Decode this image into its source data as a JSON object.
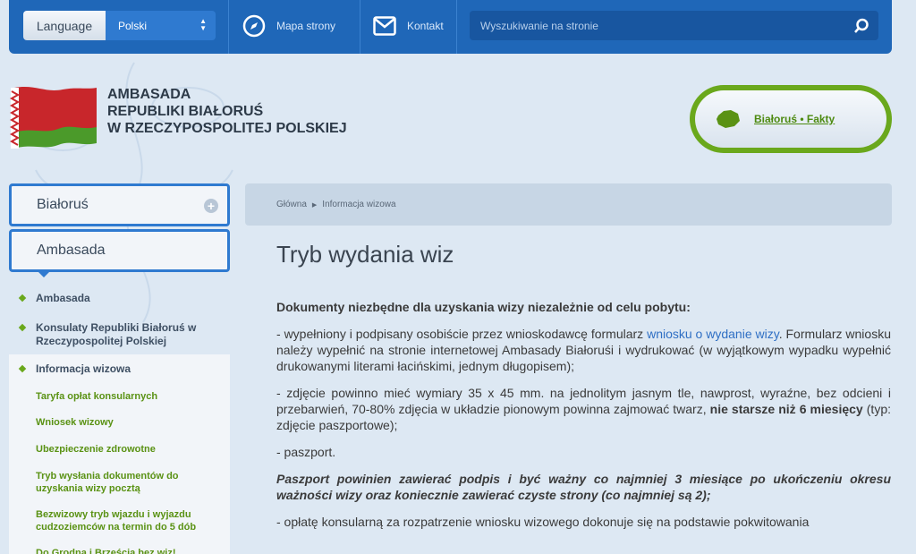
{
  "topbar": {
    "language_label": "Language",
    "language_value": "Polski",
    "sitemap": "Mapa strony",
    "contact": "Kontakt",
    "search_placeholder": "Wyszukiwanie na stronie"
  },
  "header": {
    "embassy_line1": "AMBASADA",
    "embassy_line2": "REPUBLIKI BIAŁORUŚ",
    "embassy_line3": "W RZECZYPOSPOLITEJ POLSKIEJ",
    "facts_label": "Białoruś • Fakty"
  },
  "sidebar": {
    "btn_belarus": "Białoruś",
    "btn_embassy": "Ambasada",
    "items": [
      "Ambasada",
      "Konsulaty Republiki Białoruś w Rzeczypospolitej Polskiej",
      "Informacja wizowa"
    ],
    "subitems": [
      "Taryfa opłat konsularnych",
      "Wniosek wizowy",
      "Ubezpieczenie zdrowotne",
      "Tryb wysłania dokumentów do uzyskania wizy pocztą",
      "Bezwizowy tryb wjazdu i wyjazdu cudzoziemców na termin do 5 dób",
      "Do Grodna i Brześcia bez wiz!"
    ]
  },
  "breadcrumb": {
    "home": "Główna",
    "current": "Informacja wizowa"
  },
  "main": {
    "title": "Tryb wydania wiz",
    "heading": "Dokumenty niezbędne dla uzyskania wizy niezależnie od celu pobytu:",
    "p1_pre": "- wypełniony i podpisany osobiście przez wnioskodawcę formularz ",
    "p1_link": "wniosku o wydanie wizy",
    "p1_post": ". Formularz wniosku należy wypełnić na stronie internetowej Ambasady Białoruśi i wydrukować (w wyjątkowym wypadku wypełnić drukowanymi literami łacińskimi, jednym długopisem);",
    "p2_pre": "- zdjęcie powinno mieć wymiary 35 x 45 mm. na jednolitym jasnym tle, nawprost, wyraźne, bez odcieni i przebarwień, 70-80% zdjęcia w układzie pionowym powinna zajmować twarz, ",
    "p2_bold": "nie starsze niż 6 miesięcy",
    "p2_post": " (typ: zdjęcie paszportowe);",
    "p3": "- paszport.",
    "p4": "Paszport powinien zawierać podpis i być ważny co najmniej 3 miesiące po ukończeniu okresu ważności wizy oraz koniecznie zawierać czyste strony (co najmniej są 2);",
    "p5": "- opłatę konsularną za rozpatrzenie wniosku wizowego dokonuje się na podstawie pokwitowania"
  },
  "colors": {
    "topbar": "#1f67b8",
    "accent_green": "#6aa81c",
    "link": "#2f6fc4"
  }
}
